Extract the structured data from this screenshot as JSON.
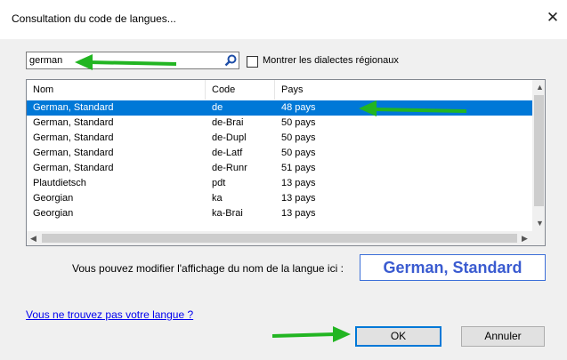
{
  "window": {
    "title": "Consultation du code de langues..."
  },
  "search": {
    "value": "german"
  },
  "options": {
    "show_dialects_label": "Montrer les dialectes régionaux"
  },
  "table": {
    "columns": [
      "Nom",
      "Code",
      "Pays"
    ],
    "rows": [
      {
        "name": "German, Standard",
        "code": "de",
        "pays": "48 pays"
      },
      {
        "name": "German, Standard",
        "code": "de-Brai",
        "pays": "50 pays"
      },
      {
        "name": "German, Standard",
        "code": "de-Dupl",
        "pays": "50 pays"
      },
      {
        "name": "German, Standard",
        "code": "de-Latf",
        "pays": "50 pays"
      },
      {
        "name": "German, Standard",
        "code": "de-Runr",
        "pays": "51 pays"
      },
      {
        "name": "Plautdietsch",
        "code": "pdt",
        "pays": "13 pays"
      },
      {
        "name": "Georgian",
        "code": "ka",
        "pays": "13 pays"
      },
      {
        "name": "Georgian",
        "code": "ka-Brai",
        "pays": "13 pays"
      }
    ]
  },
  "display_name": {
    "prompt": "Vous pouvez modifier l'affichage du nom de la langue ici :",
    "value": "German, Standard"
  },
  "help_link": "Vous ne trouvez pas votre langue ?",
  "buttons": {
    "ok": "OK",
    "cancel": "Annuler"
  },
  "colors": {
    "selection": "#0078d7",
    "annotation_arrow": "#22b522",
    "link": "#0000ee"
  }
}
